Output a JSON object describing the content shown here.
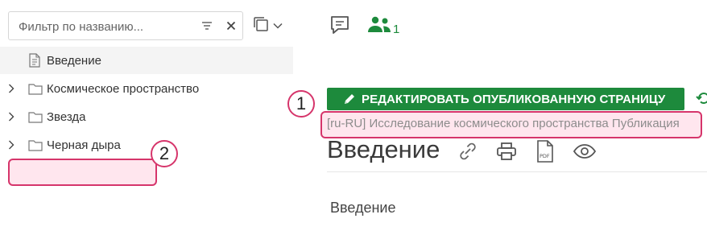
{
  "filter": {
    "placeholder": "Фильтр по названию...",
    "icons": [
      "filter-lines-icon",
      "clear-icon",
      "copy-pages-icon",
      "chevron-down-icon"
    ]
  },
  "tree": {
    "items": [
      {
        "label": "Введение",
        "icon": "document-icon",
        "expandable": false,
        "selected": true
      },
      {
        "label": "Космическое пространство",
        "icon": "folder-icon",
        "expandable": true,
        "selected": false
      },
      {
        "label": "Звезда",
        "icon": "folder-icon",
        "expandable": true,
        "selected": false
      },
      {
        "label": "Черная дыра",
        "icon": "folder-icon",
        "expandable": true,
        "selected": false
      }
    ]
  },
  "header": {
    "comment_icon": "comment-icon",
    "people_icon": "people-icon",
    "people_count": "1"
  },
  "edit_button": {
    "label": "РЕДАКТИРОВАТЬ ОПУБЛИКОВАННУЮ СТРАНИЦУ"
  },
  "breadcrumb": "[ru-RU] Исследование космического пространства Публикация",
  "page": {
    "title": "Введение",
    "content": "Введение",
    "action_icons": [
      "link-icon",
      "print-icon",
      "pdf-icon",
      "eye-icon"
    ]
  },
  "callouts": [
    "1",
    "2"
  ],
  "colors": {
    "accent_green": "#1d8a3c",
    "callout_pink": "#d6356b"
  }
}
